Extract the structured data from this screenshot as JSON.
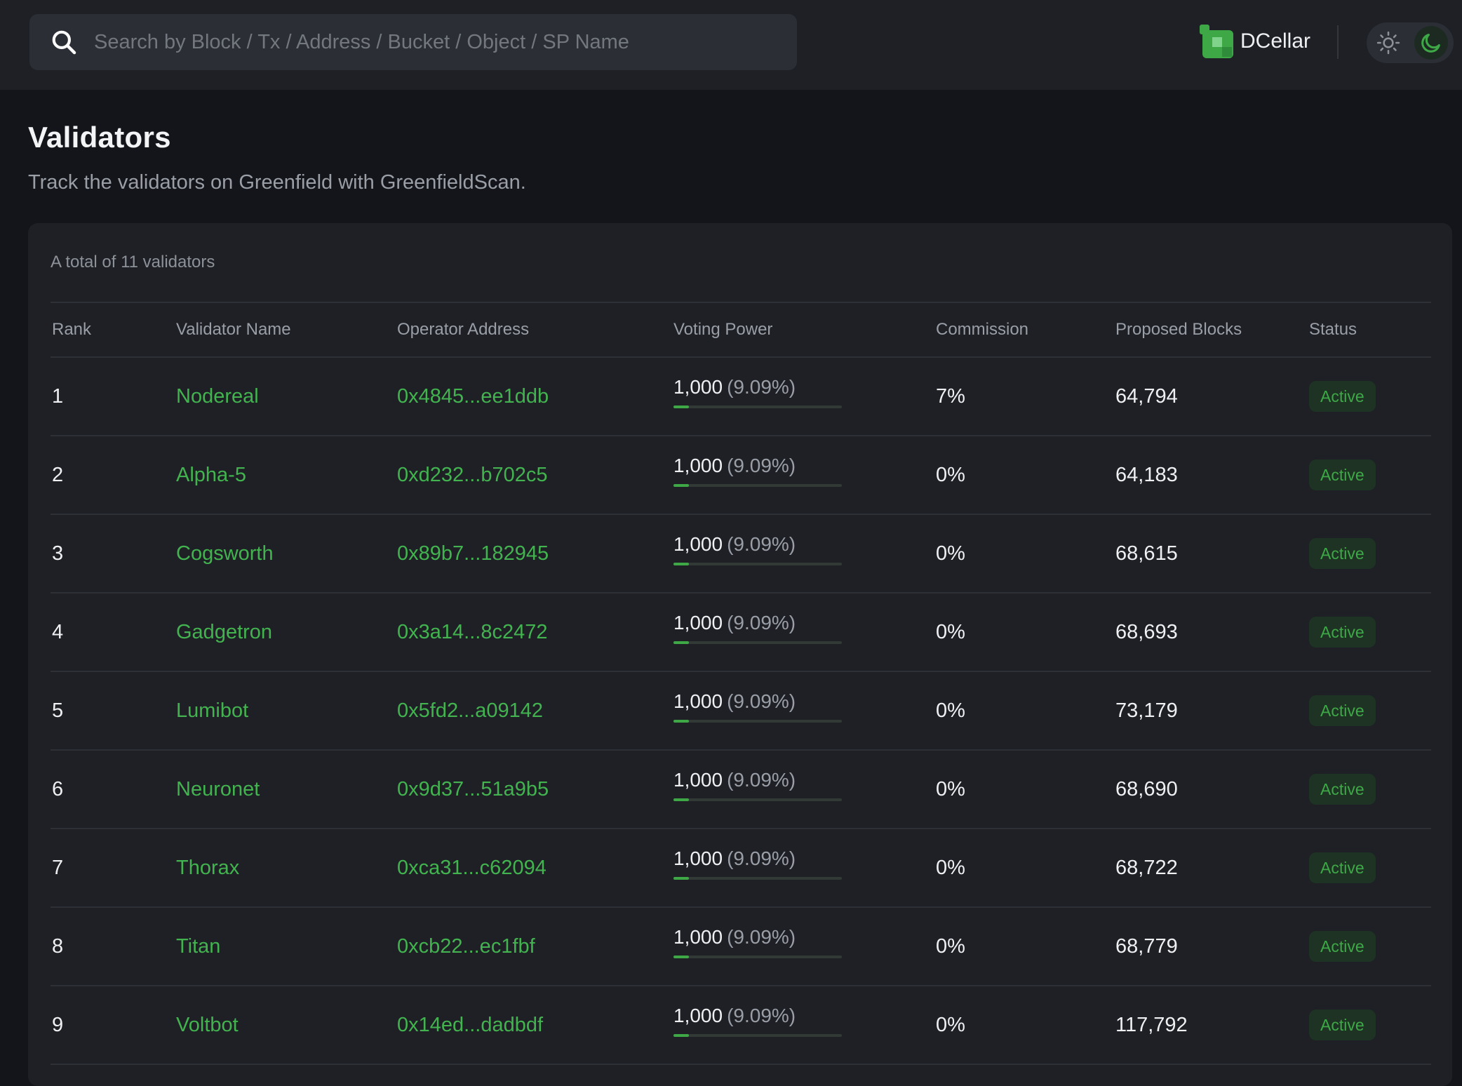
{
  "search": {
    "placeholder": "Search by Block / Tx / Address / Bucket / Object / SP Name"
  },
  "brand": {
    "name": "DCellar"
  },
  "theme": {
    "active": "dark"
  },
  "page": {
    "title": "Validators",
    "subtitle": "Track the validators on Greenfield with GreenfieldScan."
  },
  "table": {
    "total_text": "A total of 11 validators",
    "columns": [
      "Rank",
      "Validator Name",
      "Operator Address",
      "Voting Power",
      "Commission",
      "Proposed Blocks",
      "Status"
    ],
    "rows": [
      {
        "rank": "1",
        "name": "Nodereal",
        "address": "0x4845...ee1ddb",
        "power": "1,000",
        "pct": "(9.09%)",
        "power_fraction": 0.0909,
        "commission": "7%",
        "blocks": "64,794",
        "status": "Active"
      },
      {
        "rank": "2",
        "name": "Alpha-5",
        "address": "0xd232...b702c5",
        "power": "1,000",
        "pct": "(9.09%)",
        "power_fraction": 0.0909,
        "commission": "0%",
        "blocks": "64,183",
        "status": "Active"
      },
      {
        "rank": "3",
        "name": "Cogsworth",
        "address": "0x89b7...182945",
        "power": "1,000",
        "pct": "(9.09%)",
        "power_fraction": 0.0909,
        "commission": "0%",
        "blocks": "68,615",
        "status": "Active"
      },
      {
        "rank": "4",
        "name": "Gadgetron",
        "address": "0x3a14...8c2472",
        "power": "1,000",
        "pct": "(9.09%)",
        "power_fraction": 0.0909,
        "commission": "0%",
        "blocks": "68,693",
        "status": "Active"
      },
      {
        "rank": "5",
        "name": "Lumibot",
        "address": "0x5fd2...a09142",
        "power": "1,000",
        "pct": "(9.09%)",
        "power_fraction": 0.0909,
        "commission": "0%",
        "blocks": "73,179",
        "status": "Active"
      },
      {
        "rank": "6",
        "name": "Neuronet",
        "address": "0x9d37...51a9b5",
        "power": "1,000",
        "pct": "(9.09%)",
        "power_fraction": 0.0909,
        "commission": "0%",
        "blocks": "68,690",
        "status": "Active"
      },
      {
        "rank": "7",
        "name": "Thorax",
        "address": "0xca31...c62094",
        "power": "1,000",
        "pct": "(9.09%)",
        "power_fraction": 0.0909,
        "commission": "0%",
        "blocks": "68,722",
        "status": "Active"
      },
      {
        "rank": "8",
        "name": "Titan",
        "address": "0xcb22...ec1fbf",
        "power": "1,000",
        "pct": "(9.09%)",
        "power_fraction": 0.0909,
        "commission": "0%",
        "blocks": "68,779",
        "status": "Active"
      },
      {
        "rank": "9",
        "name": "Voltbot",
        "address": "0x14ed...dadbdf",
        "power": "1,000",
        "pct": "(9.09%)",
        "power_fraction": 0.0909,
        "commission": "0%",
        "blocks": "117,792",
        "status": "Active"
      }
    ]
  },
  "colors": {
    "accent": "#42b34f",
    "badge_bg": "#1f3324",
    "background": "#14151a",
    "panel": "#1e2026"
  },
  "icons": {
    "search": "search-icon",
    "brand": "dcellar-logo-icon",
    "sun": "sun-icon",
    "moon": "moon-icon"
  }
}
